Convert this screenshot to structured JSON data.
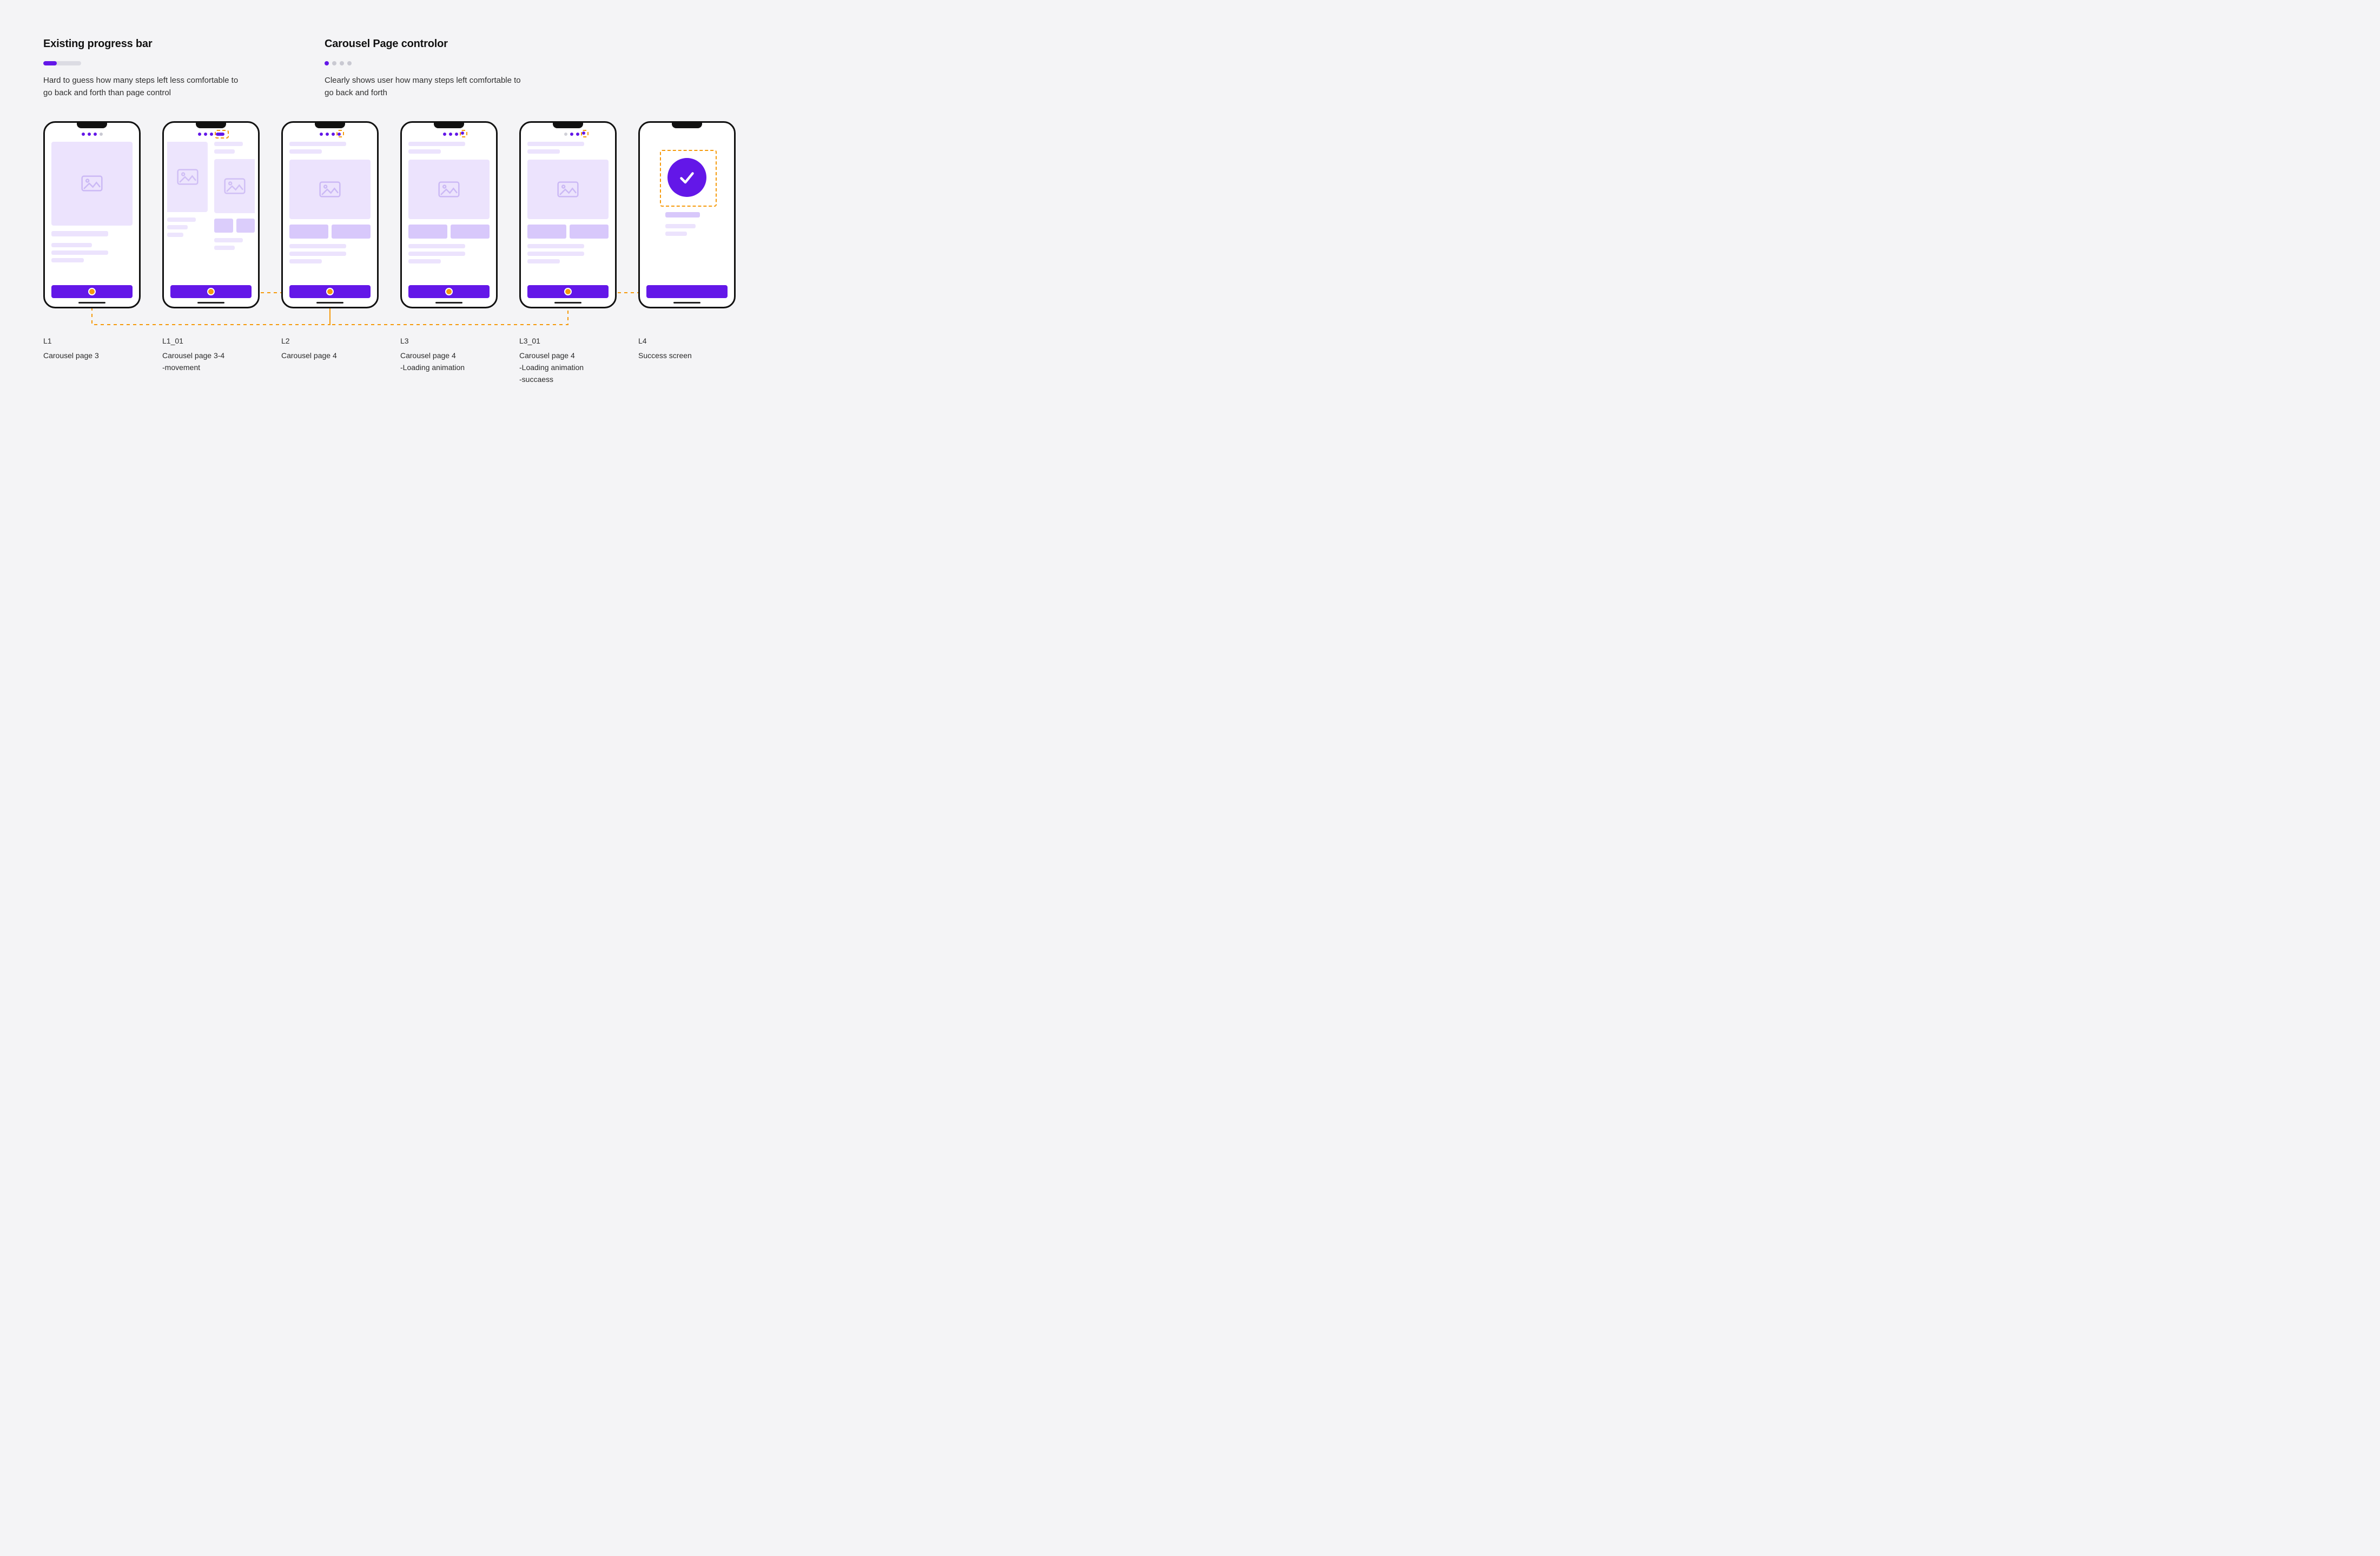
{
  "headers": {
    "left": {
      "title": "Existing progress bar",
      "desc": "Hard to guess how many steps left less comfortable to go back and forth than page control"
    },
    "right": {
      "title": "Carousel Page controlor",
      "desc": "Clearly shows user how many steps left comfortable to go back and forth"
    }
  },
  "phones": [
    {
      "id": "L1",
      "title": "Carousel page 3"
    },
    {
      "id": "L1_01",
      "title": "Carousel page 3-4\n-movement"
    },
    {
      "id": "L2",
      "title": "Carousel page 4"
    },
    {
      "id": "L3",
      "title": "Carousel page 4\n-Loading animation"
    },
    {
      "id": "L3_01",
      "title": "Carousel page 4\n-Loading animation\n-succaess"
    },
    {
      "id": "L4",
      "title": "Success screen"
    }
  ],
  "colors": {
    "accent": "#6317e8",
    "highlight": "#f59a0b"
  }
}
